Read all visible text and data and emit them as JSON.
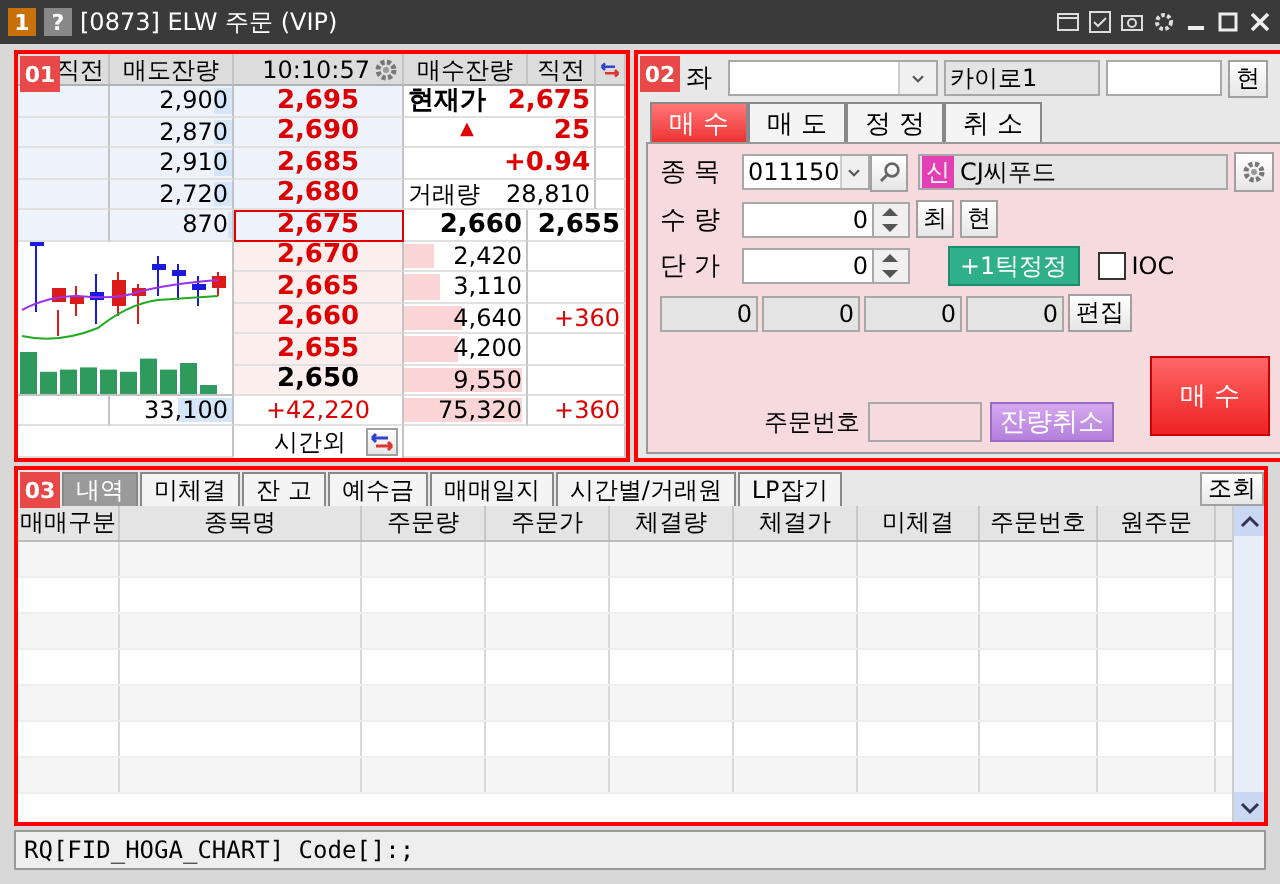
{
  "window": {
    "number": "1",
    "help": "?",
    "title": "[0873] ELW 주문 (VIP)"
  },
  "orderbook": {
    "badge": "01",
    "header": {
      "prev_left": "직전",
      "ask_qty": "매도잔량",
      "time": "10:10:57",
      "bid_qty": "매수잔량",
      "prev_right": "직전"
    },
    "asks": [
      {
        "qty": "2,900",
        "level": 0.15,
        "price": "2,695",
        "color": "#dd0000",
        "selected": false
      },
      {
        "qty": "2,870",
        "level": 0.14,
        "price": "2,690",
        "color": "#dd0000",
        "selected": false
      },
      {
        "qty": "2,910",
        "level": 0.15,
        "price": "2,685",
        "color": "#dd0000",
        "selected": false
      },
      {
        "qty": "2,720",
        "level": 0.14,
        "price": "2,680",
        "color": "#dd0000",
        "selected": false
      },
      {
        "qty": "870",
        "level": 0.04,
        "price": "2,675",
        "color": "#dd0000",
        "selected": true
      }
    ],
    "quote": [
      {
        "kind": "price",
        "label": "현재가",
        "value": "2,675"
      },
      {
        "kind": "change",
        "mark": "▲",
        "value": "25"
      },
      {
        "kind": "rate",
        "value": "+0.94"
      },
      {
        "kind": "volume",
        "label": "거래량",
        "value": "28,810"
      },
      {
        "kind": "expected",
        "label": "2,660",
        "value": "2,655"
      }
    ],
    "bids": [
      {
        "price": "2,670",
        "color": "#dd0000",
        "qty": "2,420",
        "level": 0.24,
        "selected": false
      },
      {
        "price": "2,665",
        "color": "#dd0000",
        "qty": "3,110",
        "level": 0.29,
        "selected": false
      },
      {
        "price": "2,660",
        "color": "#dd0000",
        "qty": "4,640",
        "level": 0.48,
        "change": "+360",
        "selected": false
      },
      {
        "price": "2,655",
        "color": "#dd0000",
        "qty": "4,200",
        "level": 0.45,
        "selected": false
      },
      {
        "price": "2,650",
        "color": "#000000",
        "qty": "9,550",
        "level": 0.97,
        "selected": false
      }
    ],
    "totals": {
      "ask_total": {
        "qty": "33,100",
        "level": 0.45
      },
      "net": "+42,220",
      "bid_total": {
        "qty": "75,320",
        "level": 0.97
      },
      "change": "+360"
    },
    "after_hours": "시간외"
  },
  "order": {
    "badge": "02",
    "account": {
      "label": "좌",
      "name": "카이로1",
      "button": "현"
    },
    "tabs": [
      {
        "label": "매 수",
        "selected": true
      },
      {
        "label": "매 도",
        "selected": false
      },
      {
        "label": "정 정",
        "selected": false
      },
      {
        "label": "취 소",
        "selected": false
      }
    ],
    "stock": {
      "label": "종 목",
      "code": "011150",
      "badge": "신",
      "name": "CJ씨푸드"
    },
    "quantity": {
      "label": "수 량",
      "value": "0",
      "buttons": [
        "최",
        "현"
      ]
    },
    "price": {
      "label": "단 가",
      "value": "0",
      "tick_button": "+1틱정정",
      "ioc": {
        "label": "IOC",
        "checked": false
      }
    },
    "amounts": [
      "0",
      "0",
      "0",
      "0"
    ],
    "edit_button": "편집",
    "order_no": {
      "label": "주문번호"
    },
    "cancel_button": "잔량취소",
    "submit": "매 수"
  },
  "history": {
    "badge": "03",
    "tabs": [
      {
        "label": "내역",
        "selected": true
      },
      {
        "label": "미체결",
        "selected": false
      },
      {
        "label": "잔 고",
        "selected": false
      },
      {
        "label": "예수금",
        "selected": false
      },
      {
        "label": "매매일지",
        "selected": false
      },
      {
        "label": "시간별/거래원",
        "selected": false
      },
      {
        "label": "LP잡기",
        "selected": false
      }
    ],
    "lookup_button": "조회",
    "columns": [
      "매매구분",
      "종목명",
      "주문량",
      "주문가",
      "체결량",
      "체결가",
      "미체결",
      "주문번호",
      "원주문"
    ]
  },
  "status_bar": "RQ[FID_HOGA_CHART] Code[]:;"
}
